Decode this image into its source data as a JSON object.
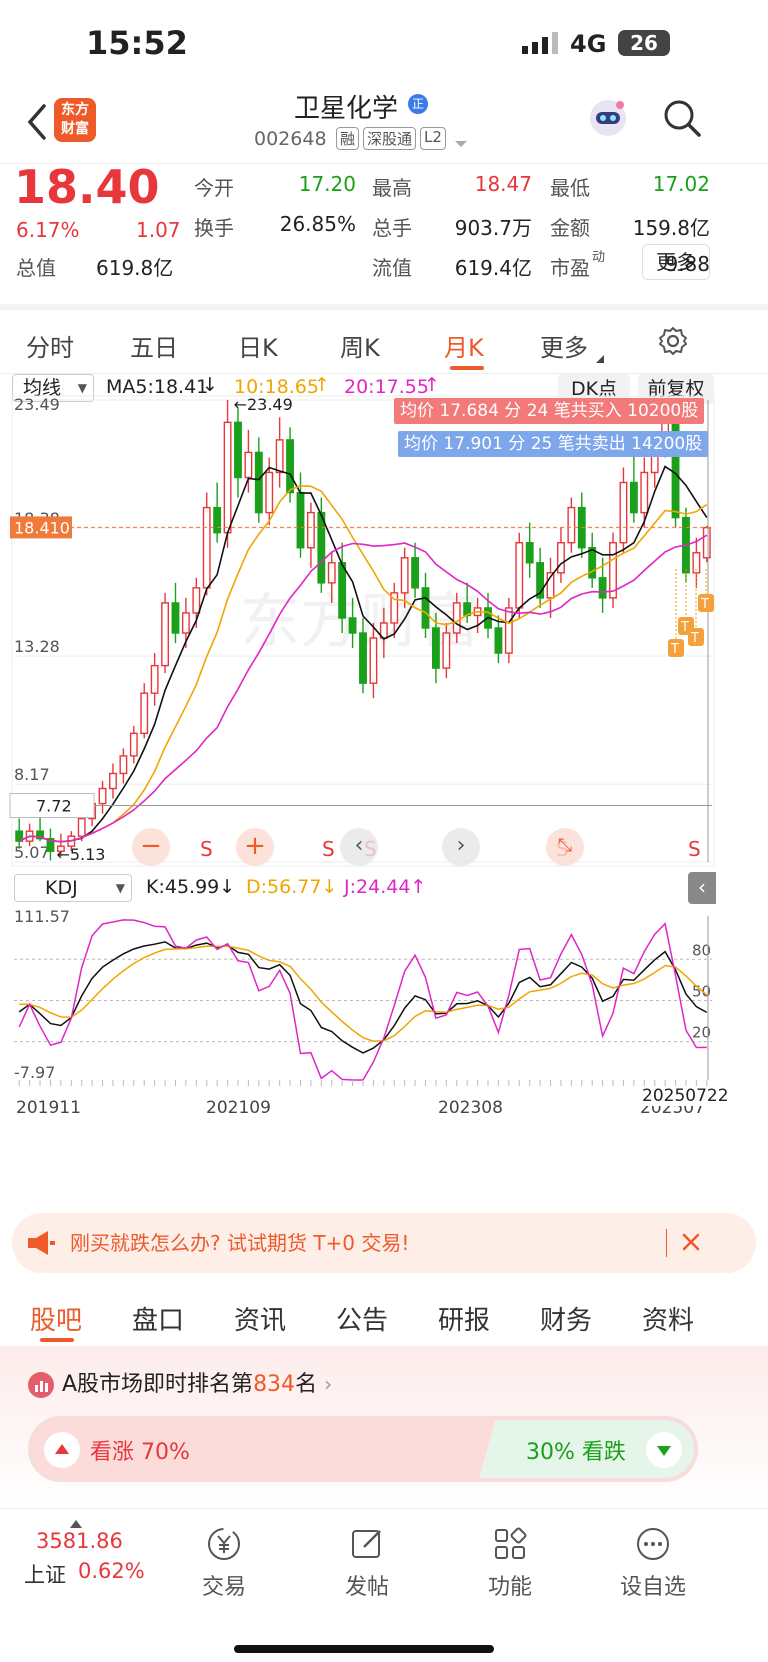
{
  "status_bar": {
    "time": "15:52",
    "network": "4G",
    "battery": "26"
  },
  "header": {
    "logo_line1": "东方",
    "logo_line2": "财富",
    "title": "卫星化学",
    "code": "002648",
    "badges": [
      "融",
      "深股通",
      "L2"
    ]
  },
  "quote": {
    "price": "18.40",
    "change_pct": "6.17%",
    "change": "1.07",
    "fields": [
      {
        "label": "今开",
        "value": "17.20",
        "color": "green"
      },
      {
        "label": "最高",
        "value": "18.47",
        "color": "red"
      },
      {
        "label": "最低",
        "value": "17.02",
        "color": "green"
      },
      {
        "label": "换手",
        "value": "26.85%",
        "color": "black"
      },
      {
        "label": "总手",
        "value": "903.7万",
        "color": "black"
      },
      {
        "label": "金额",
        "value": "159.8亿",
        "color": "black"
      },
      {
        "label": "总值",
        "value": "619.8亿",
        "color": "black"
      },
      {
        "label": "流值",
        "value": "619.4亿",
        "color": "black"
      },
      {
        "label": "市盈",
        "value": "9.88",
        "color": "black",
        "sup": "动"
      }
    ],
    "more_button": "更多"
  },
  "period_tabs": [
    "分时",
    "五日",
    "日K",
    "周K",
    "月K",
    "更多"
  ],
  "active_period": "月K",
  "chart_toolbar": {
    "ma_select": "均线",
    "ma5": "MA5:18.41",
    "ma10": "10:18.65",
    "ma20": "20:17.55",
    "dk_button": "DK点",
    "adjust_button": "前复权"
  },
  "kline": {
    "y_labels": [
      "23.49",
      "18.38",
      "13.28",
      "8.17",
      "5.07"
    ],
    "price_tag": "18.410",
    "crosshair_price": "7.72",
    "high_annotation": "←23.49",
    "low_annotation": "←5.13",
    "buy_banner": "均价 17.684 分 24 笔共买入 10200股",
    "sell_banner": "均价 17.901 分 25 笔共卖出 14200股",
    "watermark": "东方财富",
    "s_markers": [
      "S",
      "S",
      "S",
      "S",
      "S"
    ],
    "t_markers": [
      "T",
      "T",
      "T",
      "T"
    ]
  },
  "chart_data": {
    "type": "candlestick",
    "period": "monthly",
    "ylim": [
      5.07,
      23.49
    ],
    "x_ticks": [
      "201911",
      "202109",
      "202308",
      "202507"
    ],
    "candles": [
      [
        6.3,
        6.8,
        5.6,
        5.9
      ],
      [
        5.9,
        6.6,
        5.7,
        6.3
      ],
      [
        6.3,
        7.1,
        5.9,
        6.0
      ],
      [
        6.0,
        6.4,
        5.13,
        5.5
      ],
      [
        5.5,
        6.2,
        5.3,
        5.7
      ],
      [
        5.7,
        6.3,
        5.5,
        6.1
      ],
      [
        6.1,
        7.0,
        5.9,
        6.8
      ],
      [
        6.8,
        7.6,
        6.5,
        7.4
      ],
      [
        7.4,
        8.3,
        7.0,
        8.0
      ],
      [
        8.0,
        9.0,
        7.6,
        8.6
      ],
      [
        8.6,
        9.6,
        8.2,
        9.3
      ],
      [
        9.3,
        10.5,
        9.0,
        10.2
      ],
      [
        10.2,
        12.2,
        10.0,
        11.8
      ],
      [
        11.8,
        13.4,
        11.3,
        12.9
      ],
      [
        12.9,
        15.8,
        12.6,
        15.4
      ],
      [
        15.4,
        16.2,
        13.8,
        14.2
      ],
      [
        14.2,
        15.6,
        13.6,
        15.0
      ],
      [
        15.0,
        16.4,
        14.4,
        16.0
      ],
      [
        16.0,
        19.8,
        15.7,
        19.2
      ],
      [
        19.2,
        20.2,
        17.8,
        18.2
      ],
      [
        18.2,
        23.49,
        17.6,
        22.6
      ],
      [
        22.6,
        23.2,
        19.6,
        20.4
      ],
      [
        20.4,
        22.3,
        19.8,
        21.4
      ],
      [
        21.4,
        22.0,
        18.6,
        19.0
      ],
      [
        19.0,
        21.2,
        18.5,
        20.6
      ],
      [
        20.6,
        22.8,
        20.0,
        21.9
      ],
      [
        21.9,
        22.4,
        19.4,
        19.8
      ],
      [
        19.8,
        20.6,
        17.2,
        17.6
      ],
      [
        17.6,
        19.4,
        16.8,
        19.0
      ],
      [
        19.0,
        19.6,
        15.8,
        16.2
      ],
      [
        16.2,
        17.4,
        15.4,
        17.0
      ],
      [
        17.0,
        17.8,
        14.2,
        14.8
      ],
      [
        14.8,
        15.6,
        13.6,
        14.2
      ],
      [
        14.2,
        14.8,
        11.8,
        12.2
      ],
      [
        12.2,
        14.6,
        11.6,
        14.0
      ],
      [
        14.0,
        15.2,
        13.2,
        14.6
      ],
      [
        14.6,
        16.2,
        14.0,
        15.8
      ],
      [
        15.8,
        17.6,
        15.2,
        17.2
      ],
      [
        17.2,
        17.8,
        15.6,
        16.0
      ],
      [
        16.0,
        16.6,
        14.0,
        14.4
      ],
      [
        14.4,
        15.0,
        12.2,
        12.8
      ],
      [
        12.8,
        14.6,
        12.4,
        14.2
      ],
      [
        14.2,
        15.8,
        13.8,
        15.4
      ],
      [
        15.4,
        16.2,
        14.6,
        14.9
      ],
      [
        14.9,
        15.6,
        14.2,
        15.2
      ],
      [
        15.2,
        15.8,
        14.0,
        14.4
      ],
      [
        14.4,
        14.9,
        13.0,
        13.4
      ],
      [
        13.4,
        15.6,
        13.0,
        15.2
      ],
      [
        15.2,
        18.2,
        14.8,
        17.8
      ],
      [
        17.8,
        18.6,
        16.4,
        17.0
      ],
      [
        17.0,
        17.6,
        15.2,
        15.6
      ],
      [
        15.6,
        17.2,
        14.8,
        16.6
      ],
      [
        16.6,
        18.4,
        16.2,
        17.8
      ],
      [
        17.8,
        19.6,
        17.4,
        19.2
      ],
      [
        19.2,
        19.8,
        17.2,
        17.6
      ],
      [
        17.6,
        18.2,
        16.0,
        16.4
      ],
      [
        16.4,
        17.2,
        15.0,
        15.6
      ],
      [
        15.6,
        18.2,
        15.2,
        17.8
      ],
      [
        17.8,
        20.8,
        17.4,
        20.2
      ],
      [
        20.2,
        21.4,
        18.6,
        19.0
      ],
      [
        19.0,
        21.2,
        18.4,
        20.6
      ],
      [
        20.6,
        22.0,
        20.0,
        21.6
      ],
      [
        21.6,
        23.0,
        21.2,
        22.8
      ],
      [
        22.8,
        23.3,
        18.4,
        18.8
      ],
      [
        18.8,
        19.2,
        16.2,
        16.6
      ],
      [
        16.6,
        18.0,
        16.0,
        17.4
      ],
      [
        17.2,
        18.47,
        17.02,
        18.4
      ]
    ],
    "kdj": {
      "ylim": [
        -7.97,
        111.57
      ],
      "levels": [
        80,
        50,
        20
      ],
      "K": "45.99",
      "D": "56.77",
      "J": "24.44"
    },
    "kdj_latest_date": "20250722",
    "kdj_select": "KDJ",
    "kdj_top": "111.57",
    "kdj_bottom": "-7.97"
  },
  "chart_controls": [
    "zoom-out",
    "zoom-in",
    "prev",
    "next",
    "fullscreen"
  ],
  "banner": {
    "text": "刚买就跌怎么办? 试试期货 T+0 交易!"
  },
  "sub_tabs": [
    "股吧",
    "盘口",
    "资讯",
    "公告",
    "研报",
    "财务",
    "资料"
  ],
  "active_sub_tab": "股吧",
  "ranking": {
    "prefix": "A股市场即时排名第",
    "rank": "834",
    "suffix": "名"
  },
  "sentiment": {
    "up_label": "看涨",
    "up_pct": "70%",
    "down_label": "看跌",
    "down_pct": "30%",
    "up_share": 0.7
  },
  "bottom_bar": {
    "index_value": "3581.86",
    "index_name": "上证",
    "index_change": "0.62%",
    "items": [
      "交易",
      "发帖",
      "功能",
      "设自选"
    ]
  }
}
